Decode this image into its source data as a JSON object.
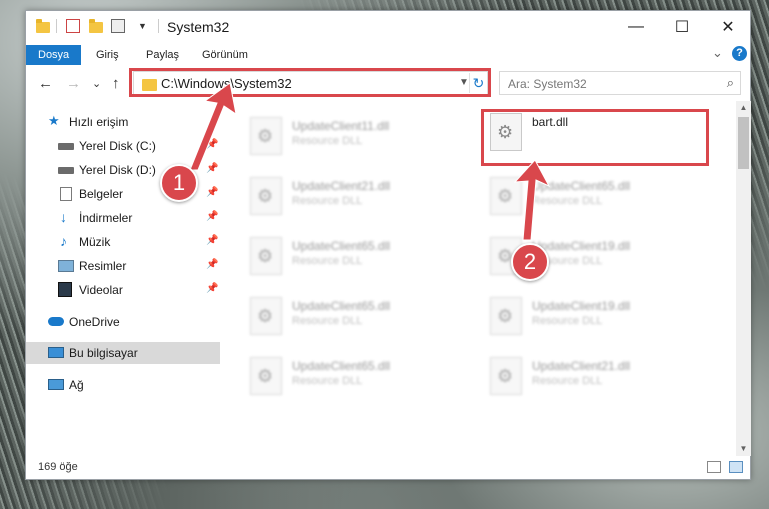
{
  "window": {
    "title": "System32",
    "controls": {
      "minimize": "—",
      "maximize": "☐",
      "close": "✕"
    }
  },
  "ribbon": {
    "tabs": [
      {
        "label": "Dosya",
        "active": true
      },
      {
        "label": "Giriş",
        "active": false
      },
      {
        "label": "Paylaş",
        "active": false
      },
      {
        "label": "Görünüm",
        "active": false
      }
    ],
    "expand_icon": "⌄",
    "help_icon": "?"
  },
  "nav": {
    "back": "←",
    "forward": "→",
    "recent": "⌄",
    "up": "↑"
  },
  "address": {
    "path": "C:\\Windows\\System32",
    "refresh": "↻"
  },
  "search": {
    "placeholder": "Ara: System32",
    "icon": "⌕"
  },
  "sidebar": {
    "items": [
      {
        "label": "Hızlı erişim",
        "icon": "star-icon"
      },
      {
        "label": "Yerel Disk (C:)",
        "icon": "drive-icon",
        "pinned": true
      },
      {
        "label": "Yerel Disk (D:)",
        "icon": "drive-icon",
        "pinned": true
      },
      {
        "label": "Belgeler",
        "icon": "documents-icon",
        "pinned": true
      },
      {
        "label": "İndirmeler",
        "icon": "download-icon",
        "pinned": true
      },
      {
        "label": "Müzik",
        "icon": "music-icon",
        "pinned": true
      },
      {
        "label": "Resimler",
        "icon": "pictures-icon",
        "pinned": true
      },
      {
        "label": "Videolar",
        "icon": "video-icon",
        "pinned": true
      },
      {
        "label": "OneDrive",
        "icon": "cloud-icon"
      },
      {
        "label": "Bu bilgisayar",
        "icon": "computer-icon",
        "selected": true
      },
      {
        "label": "Ağ",
        "icon": "network-icon"
      }
    ]
  },
  "files": [
    {
      "name": "UpdateClient11.dll",
      "type": "Resource DLL",
      "blurred": true
    },
    {
      "name": "bart.dll",
      "type": "",
      "blurred": false,
      "highlighted": true
    },
    {
      "name": "UpdateClient21.dll",
      "type": "Resource DLL",
      "blurred": true
    },
    {
      "name": "UpdateClient65.dll",
      "type": "Resource DLL",
      "blurred": true
    },
    {
      "name": "UpdateClient65.dll",
      "type": "Resource DLL",
      "blurred": true
    },
    {
      "name": "UpdateClient19.dll",
      "type": "Resource DLL",
      "blurred": true
    },
    {
      "name": "UpdateClient65.dll",
      "type": "Resource DLL",
      "blurred": true
    },
    {
      "name": "UpdateClient19.dll",
      "type": "Resource DLL",
      "blurred": true
    },
    {
      "name": "UpdateClient65.dll",
      "type": "Resource DLL",
      "blurred": true
    },
    {
      "name": "UpdateClient21.dll",
      "type": "Resource DLL",
      "blurred": true
    }
  ],
  "status": {
    "count": "169 öğe"
  },
  "annotations": {
    "step1": "1",
    "step2": "2",
    "color": "#d9474c"
  },
  "colors": {
    "accent": "#1979ca",
    "folder": "#f4c542",
    "selection": "#d9d9d9"
  }
}
